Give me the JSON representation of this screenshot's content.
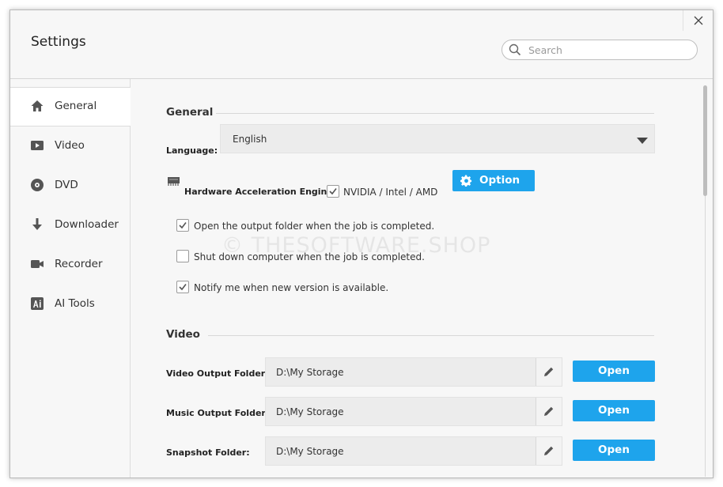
{
  "window": {
    "title": "Settings"
  },
  "search": {
    "placeholder": "Search",
    "value": ""
  },
  "sidebar": {
    "items": [
      {
        "label": "General",
        "icon": "home-icon",
        "active": true
      },
      {
        "label": "Video",
        "icon": "video-play-icon",
        "active": false
      },
      {
        "label": "DVD",
        "icon": "disc-icon",
        "active": false
      },
      {
        "label": "Downloader",
        "icon": "download-arrow-icon",
        "active": false
      },
      {
        "label": "Recorder",
        "icon": "camera-icon",
        "active": false
      },
      {
        "label": "AI Tools",
        "icon": "ai-icon",
        "active": false
      }
    ]
  },
  "general": {
    "title": "General",
    "language_label": "Language:",
    "language_value": "English",
    "hw_label": "Hardware Acceleration Engine:",
    "hw_option_label": "NVIDIA / Intel / AMD",
    "hw_checked": true,
    "option_button": "Option",
    "checks": [
      {
        "label": "Open the output folder when the job is completed.",
        "checked": true
      },
      {
        "label": "Shut down computer when the job is completed.",
        "checked": false
      },
      {
        "label": "Notify me when new version is available.",
        "checked": true
      }
    ]
  },
  "video": {
    "title": "Video",
    "folders": [
      {
        "label": "Video Output Folder:",
        "path": "D:\\My Storage",
        "button": "Open"
      },
      {
        "label": "Music Output Folder:",
        "path": "D:\\My Storage",
        "button": "Open"
      },
      {
        "label": "Snapshot Folder:",
        "path": "D:\\My Storage",
        "button": "Open"
      }
    ]
  },
  "watermark": "© THESOFTWARE.SHOP",
  "colors": {
    "accent": "#1ea4ec",
    "field_bg": "#ececec",
    "window_bg": "#f7f7f7"
  }
}
